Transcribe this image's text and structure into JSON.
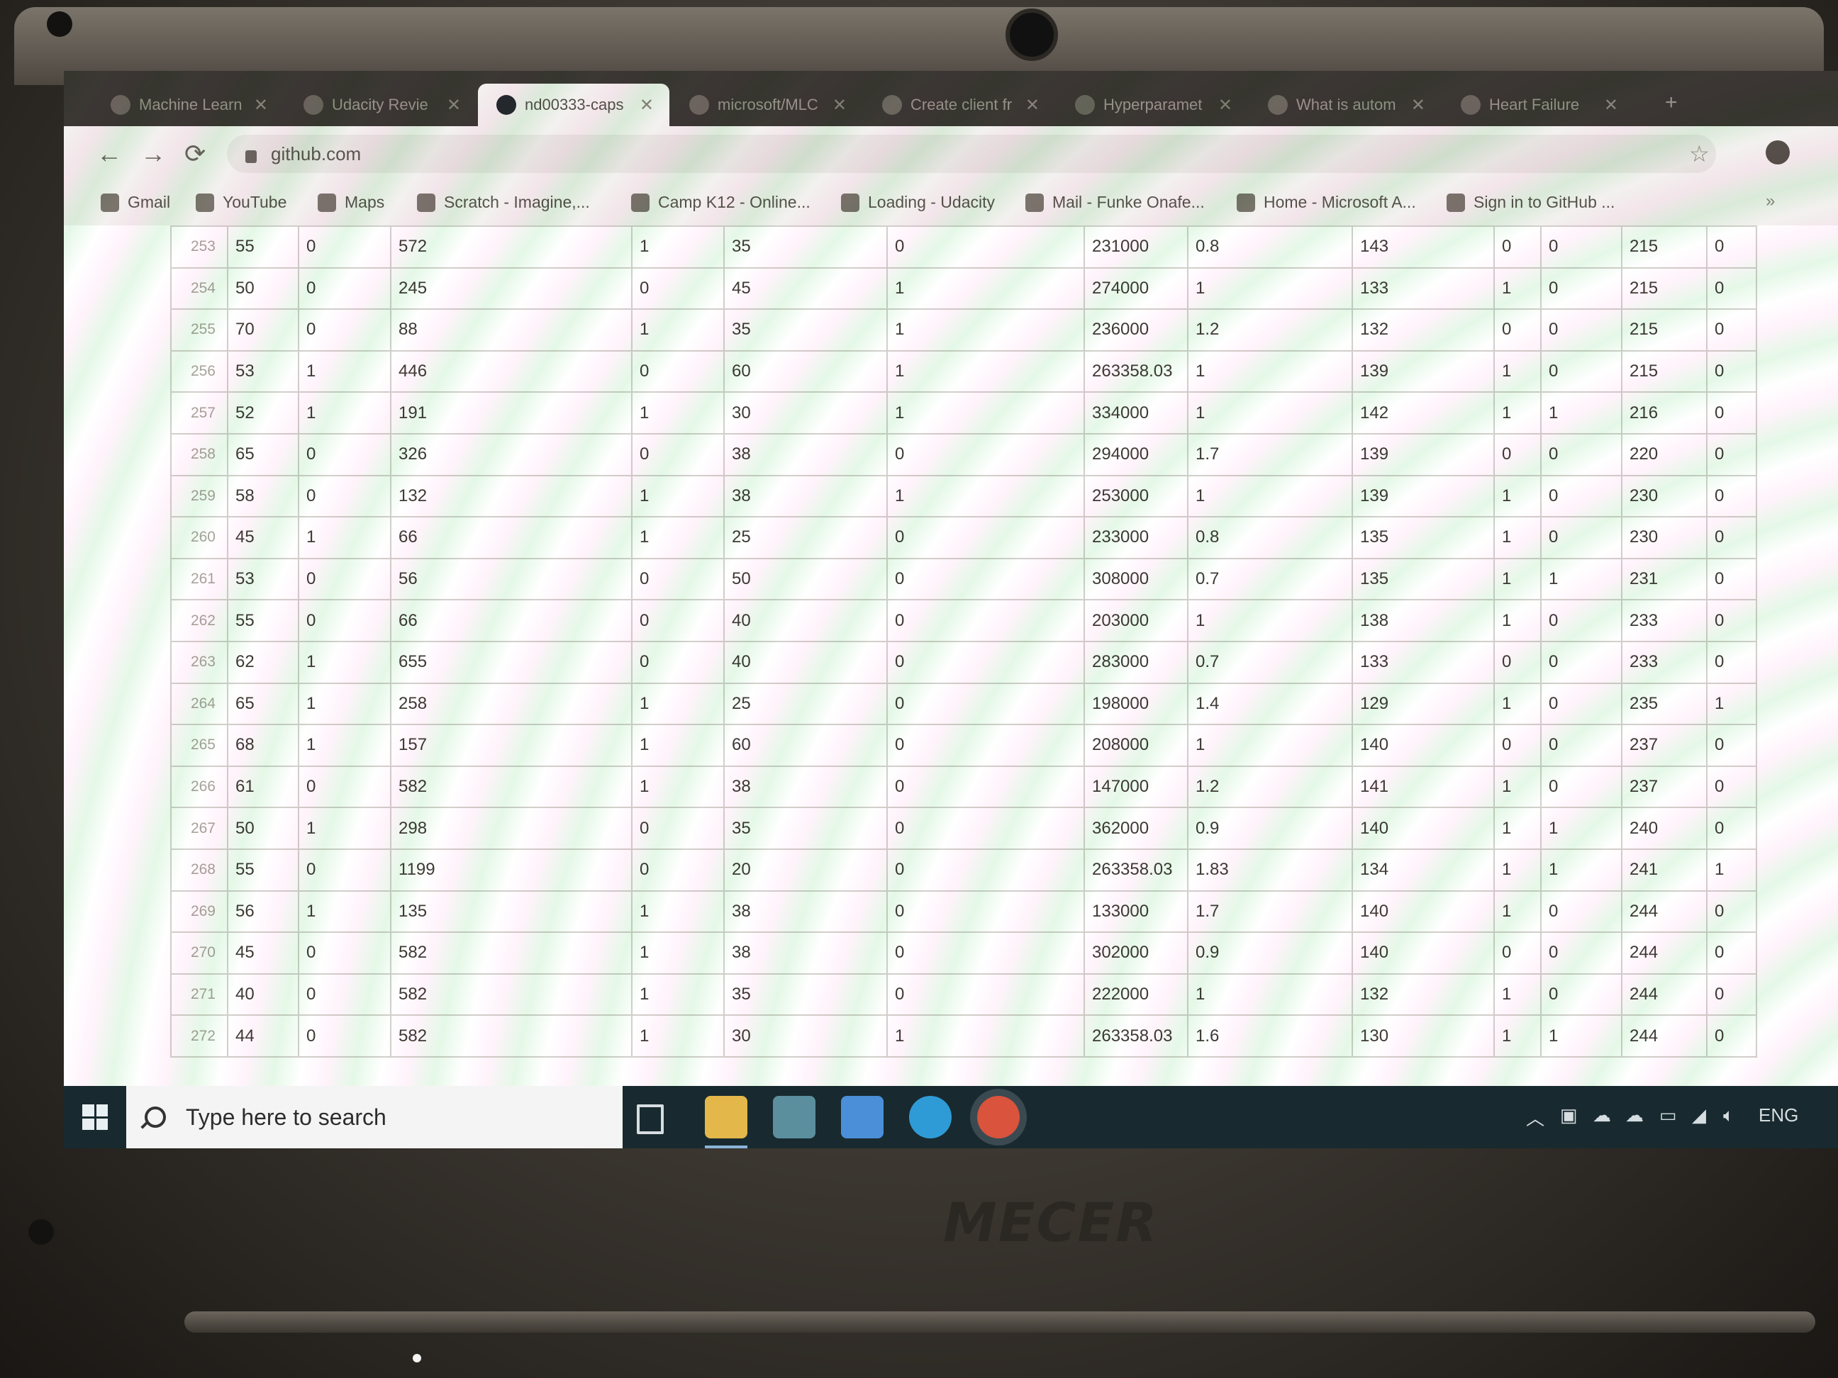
{
  "browser": {
    "tabs": [
      {
        "label": "Machine Learn",
        "active": false
      },
      {
        "label": "Udacity Revie",
        "active": false
      },
      {
        "label": "nd00333-caps",
        "active": true
      },
      {
        "label": "microsoft/MLC",
        "active": false
      },
      {
        "label": "Create client fr",
        "active": false
      },
      {
        "label": "Hyperparamet",
        "active": false
      },
      {
        "label": "What is autom",
        "active": false
      },
      {
        "label": "Heart Failure",
        "active": false
      }
    ],
    "new_tab": "+",
    "url": "github.com",
    "bookmarks": [
      "Gmail",
      "YouTube",
      "Maps",
      "Scratch - Imagine,...",
      "Camp K12 - Online...",
      "Loading - Udacity",
      "Mail - Funke Onafe...",
      "Home - Microsoft A...",
      "Sign in to GitHub ..."
    ],
    "bookmarks_more": "»"
  },
  "table": {
    "rows": [
      [
        "253",
        "55",
        "0",
        "572",
        "1",
        "35",
        "0",
        "231000",
        "0.8",
        "143",
        "0",
        "0",
        "215",
        "0"
      ],
      [
        "254",
        "50",
        "0",
        "245",
        "0",
        "45",
        "1",
        "274000",
        "1",
        "133",
        "1",
        "0",
        "215",
        "0"
      ],
      [
        "255",
        "70",
        "0",
        "88",
        "1",
        "35",
        "1",
        "236000",
        "1.2",
        "132",
        "0",
        "0",
        "215",
        "0"
      ],
      [
        "256",
        "53",
        "1",
        "446",
        "0",
        "60",
        "1",
        "263358.03",
        "1",
        "139",
        "1",
        "0",
        "215",
        "0"
      ],
      [
        "257",
        "52",
        "1",
        "191",
        "1",
        "30",
        "1",
        "334000",
        "1",
        "142",
        "1",
        "1",
        "216",
        "0"
      ],
      [
        "258",
        "65",
        "0",
        "326",
        "0",
        "38",
        "0",
        "294000",
        "1.7",
        "139",
        "0",
        "0",
        "220",
        "0"
      ],
      [
        "259",
        "58",
        "0",
        "132",
        "1",
        "38",
        "1",
        "253000",
        "1",
        "139",
        "1",
        "0",
        "230",
        "0"
      ],
      [
        "260",
        "45",
        "1",
        "66",
        "1",
        "25",
        "0",
        "233000",
        "0.8",
        "135",
        "1",
        "0",
        "230",
        "0"
      ],
      [
        "261",
        "53",
        "0",
        "56",
        "0",
        "50",
        "0",
        "308000",
        "0.7",
        "135",
        "1",
        "1",
        "231",
        "0"
      ],
      [
        "262",
        "55",
        "0",
        "66",
        "0",
        "40",
        "0",
        "203000",
        "1",
        "138",
        "1",
        "0",
        "233",
        "0"
      ],
      [
        "263",
        "62",
        "1",
        "655",
        "0",
        "40",
        "0",
        "283000",
        "0.7",
        "133",
        "0",
        "0",
        "233",
        "0"
      ],
      [
        "264",
        "65",
        "1",
        "258",
        "1",
        "25",
        "0",
        "198000",
        "1.4",
        "129",
        "1",
        "0",
        "235",
        "1"
      ],
      [
        "265",
        "68",
        "1",
        "157",
        "1",
        "60",
        "0",
        "208000",
        "1",
        "140",
        "0",
        "0",
        "237",
        "0"
      ],
      [
        "266",
        "61",
        "0",
        "582",
        "1",
        "38",
        "0",
        "147000",
        "1.2",
        "141",
        "1",
        "0",
        "237",
        "0"
      ],
      [
        "267",
        "50",
        "1",
        "298",
        "0",
        "35",
        "0",
        "362000",
        "0.9",
        "140",
        "1",
        "1",
        "240",
        "0"
      ],
      [
        "268",
        "55",
        "0",
        "1199",
        "0",
        "20",
        "0",
        "263358.03",
        "1.83",
        "134",
        "1",
        "1",
        "241",
        "1"
      ],
      [
        "269",
        "56",
        "1",
        "135",
        "1",
        "38",
        "0",
        "133000",
        "1.7",
        "140",
        "1",
        "0",
        "244",
        "0"
      ],
      [
        "270",
        "45",
        "0",
        "582",
        "1",
        "38",
        "0",
        "302000",
        "0.9",
        "140",
        "0",
        "0",
        "244",
        "0"
      ],
      [
        "271",
        "40",
        "0",
        "582",
        "1",
        "35",
        "0",
        "222000",
        "1",
        "132",
        "1",
        "0",
        "244",
        "0"
      ],
      [
        "272",
        "44",
        "0",
        "582",
        "1",
        "30",
        "1",
        "263358.03",
        "1.6",
        "130",
        "1",
        "1",
        "244",
        "0"
      ]
    ]
  },
  "taskbar": {
    "search_placeholder": "Type here to search",
    "language": "ENG"
  },
  "device": {
    "brand": "MECER"
  },
  "colors": {
    "tabstrip": "#3b3733",
    "taskbar": "#182a2f",
    "table_border": "#d3d0cc"
  }
}
